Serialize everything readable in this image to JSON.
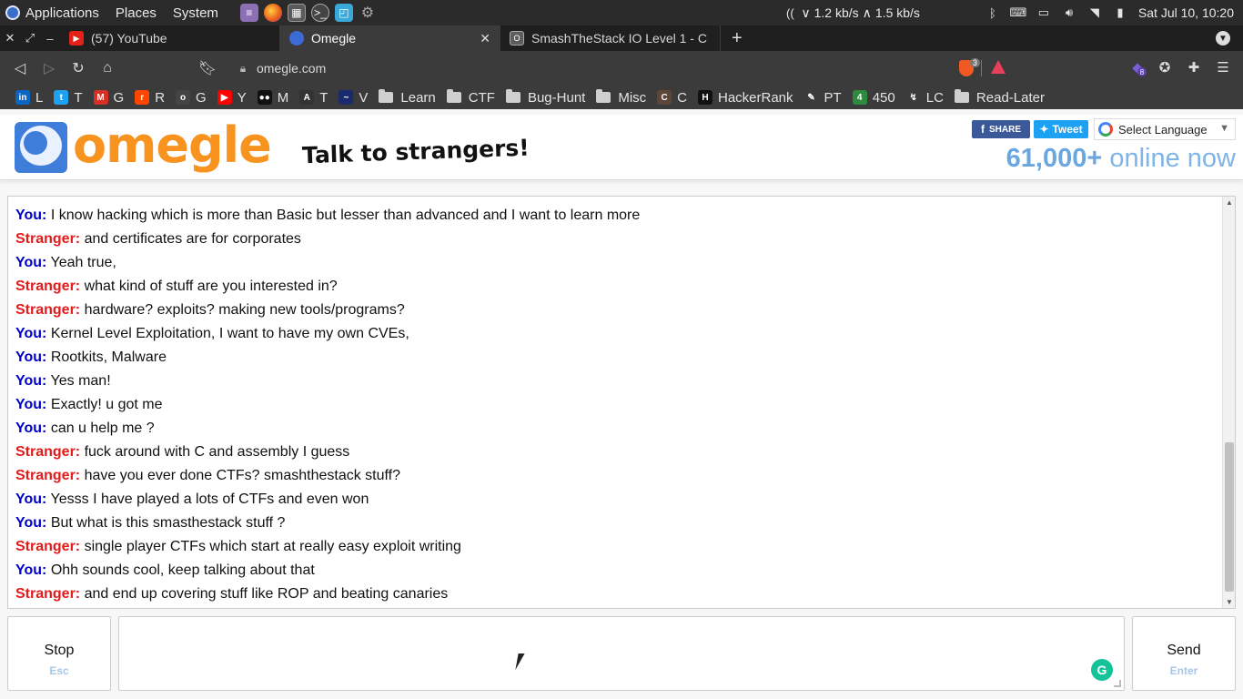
{
  "os_panel": {
    "menus": [
      "Applications",
      "Places",
      "System"
    ],
    "net_down": "1.2 kb/s",
    "net_up": "1.5 kb/s",
    "clock": "Sat Jul 10, 10:20"
  },
  "tabs": [
    {
      "title": "(57) YouTube",
      "icon": "youtube-icon",
      "active": false
    },
    {
      "title": "Omegle",
      "icon": "omegle-icon",
      "active": true
    },
    {
      "title": "SmashTheStack IO Level 1 - C",
      "icon": "smashthestack-icon",
      "active": false
    }
  ],
  "address_bar": {
    "url": "omegle.com",
    "brave_shield_count": "3",
    "extension_badge": "8"
  },
  "bookmarks": [
    {
      "label": "L",
      "icon": "linkedin-icon",
      "color": "#0a66c2",
      "glyph": "in"
    },
    {
      "label": "T",
      "icon": "twitter-icon",
      "color": "#1da1f2",
      "glyph": "t"
    },
    {
      "label": "G",
      "icon": "gmail-icon",
      "color": "#d93025",
      "glyph": "M"
    },
    {
      "label": "R",
      "icon": "reddit-icon",
      "color": "#ff4500",
      "glyph": "r"
    },
    {
      "label": "G",
      "icon": "github-icon",
      "color": "#444444",
      "glyph": "o"
    },
    {
      "label": "Y",
      "icon": "youtube-icon",
      "color": "#ff0000",
      "glyph": "▶"
    },
    {
      "label": "M",
      "icon": "medium-icon",
      "color": "#111111",
      "glyph": "●●"
    },
    {
      "label": "T",
      "icon": "tryhackme-icon",
      "color": "#333333",
      "glyph": "A"
    },
    {
      "label": "V",
      "icon": "vulnhub-icon",
      "color": "#1a2a6c",
      "glyph": "~"
    },
    {
      "label": "Learn",
      "icon": "folder-icon",
      "folder": true
    },
    {
      "label": "CTF",
      "icon": "folder-icon",
      "folder": true
    },
    {
      "label": "Bug-Hunt",
      "icon": "folder-icon",
      "folder": true
    },
    {
      "label": "Misc",
      "icon": "folder-icon",
      "folder": true
    },
    {
      "label": "C",
      "icon": "codechef-icon",
      "color": "#5b4638",
      "glyph": "C"
    },
    {
      "label": "HackerRank",
      "icon": "hackerrank-icon",
      "color": "#111111",
      "glyph": "H"
    },
    {
      "label": "PT",
      "icon": "pentest-icon",
      "color": "#3b3b3b",
      "glyph": "✎"
    },
    {
      "label": "450",
      "icon": "four-icon",
      "color": "#2e8b3e",
      "glyph": "4"
    },
    {
      "label": "LC",
      "icon": "leetcode-icon",
      "color": "#3b3b3b",
      "glyph": "↯"
    },
    {
      "label": "Read-Later",
      "icon": "folder-icon",
      "folder": true
    }
  ],
  "omegle": {
    "logo_text": "omegle",
    "tagline": "Talk to strangers!",
    "share_label": "SHARE",
    "tweet_label": "Tweet",
    "language_label": "Select Language",
    "online_count": "61,000+",
    "online_text": "online now",
    "colors": {
      "you": "#0000cc",
      "stranger": "#e21b1b",
      "logo_orange": "#f7931e",
      "logo_blue": "#3f7ddb"
    }
  },
  "chat_log": [
    {
      "speaker": "You:",
      "role": "you",
      "text": "I know hacking which is more than Basic but lesser than advanced and I want to learn more"
    },
    {
      "speaker": "Stranger:",
      "role": "stranger",
      "text": "and certificates are for corporates"
    },
    {
      "speaker": "You:",
      "role": "you",
      "text": "Yeah true,"
    },
    {
      "speaker": "Stranger:",
      "role": "stranger",
      "text": "what kind of stuff are you interested in?"
    },
    {
      "speaker": "Stranger:",
      "role": "stranger",
      "text": "hardware? exploits? making new tools/programs?"
    },
    {
      "speaker": "You:",
      "role": "you",
      "text": "Kernel Level Exploitation, I want to have my own CVEs,"
    },
    {
      "speaker": "You:",
      "role": "you",
      "text": "Rootkits, Malware"
    },
    {
      "speaker": "You:",
      "role": "you",
      "text": "Yes man!"
    },
    {
      "speaker": "You:",
      "role": "you",
      "text": "Exactly! u got me"
    },
    {
      "speaker": "You:",
      "role": "you",
      "text": "can u help me ?"
    },
    {
      "speaker": "Stranger:",
      "role": "stranger",
      "text": "fuck around with C and assembly I guess"
    },
    {
      "speaker": "Stranger:",
      "role": "stranger",
      "text": "have you ever done CTFs? smashthestack stuff?"
    },
    {
      "speaker": "You:",
      "role": "you",
      "text": "Yesss I have played a lots of CTFs and even won"
    },
    {
      "speaker": "You:",
      "role": "you",
      "text": "But what is this smasthestack stuff ?"
    },
    {
      "speaker": "Stranger:",
      "role": "stranger",
      "text": "single player CTFs which start at really easy exploit writing"
    },
    {
      "speaker": "You:",
      "role": "you",
      "text": "Ohh sounds cool, keep talking about that"
    },
    {
      "speaker": "Stranger:",
      "role": "stranger",
      "text": "and end up covering stuff like ROP and beating canaries"
    }
  ],
  "controls": {
    "stop_label": "Stop",
    "stop_hint": "Esc",
    "send_label": "Send",
    "send_hint": "Enter",
    "message_value": ""
  }
}
